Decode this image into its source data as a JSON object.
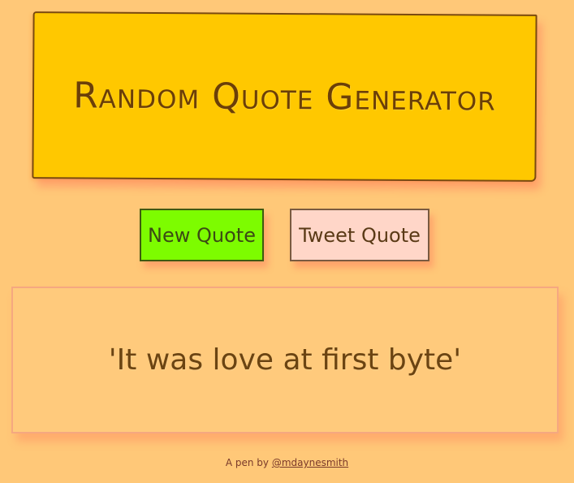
{
  "header": {
    "title": "Random Quote Generator"
  },
  "buttons": {
    "new_quote_label": "New Quote",
    "tweet_quote_label": "Tweet Quote"
  },
  "quote": {
    "text": "'It was love at first byte'"
  },
  "footer": {
    "prefix": "A pen by",
    "author_link": "@mdaynesmith"
  },
  "colors": {
    "background": "#ffc878",
    "header_bg": "#ffc800",
    "new_quote_bg": "#7dfc00",
    "tweet_quote_bg": "#ffd6c8",
    "text": "#6b3f08"
  }
}
